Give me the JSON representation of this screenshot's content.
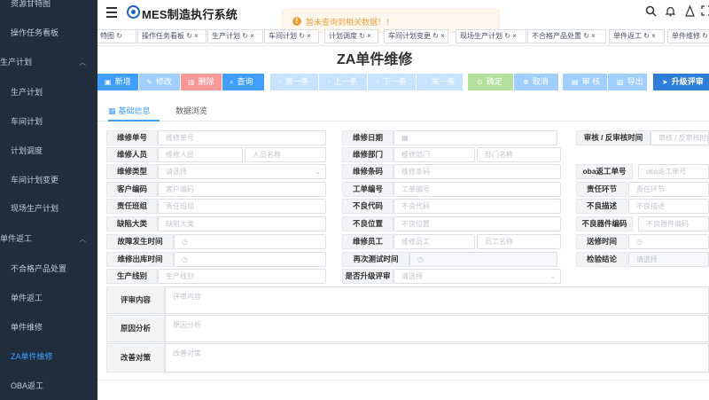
{
  "app": {
    "title": "MES制造执行系统"
  },
  "sidebar": {
    "items": [
      {
        "label": "资源甘特图"
      },
      {
        "label": "操作任务看板"
      },
      {
        "label": "生产计划",
        "chevron": "︿"
      },
      {
        "label": "生产计划"
      },
      {
        "label": "车间计划"
      },
      {
        "label": "计划调度"
      },
      {
        "label": "车间计划变更"
      },
      {
        "label": "现场生产计划"
      },
      {
        "label": "单件返工",
        "chevron": "︿"
      },
      {
        "label": "不合格产品处置"
      },
      {
        "label": "单件返工"
      },
      {
        "label": "单件维修"
      },
      {
        "label": "ZA单件维修"
      },
      {
        "label": "OBA返工"
      }
    ]
  },
  "toast": {
    "text": "暂未查询到相关数据！！"
  },
  "tags": [
    {
      "label": "特图 ↻"
    },
    {
      "label": "操作任务看板 ↻ ×"
    },
    {
      "label": "生产计划 ↻ ×"
    },
    {
      "label": "车间计划 ↻ ×"
    },
    {
      "label": "计划调度 ↻ ×"
    },
    {
      "label": "车间计划变更 ↻ ×"
    },
    {
      "label": "现场生产计划 ↻ ×"
    },
    {
      "label": "不合格产品处置 ↻ ×"
    },
    {
      "label": "单件返工 ↻ ×"
    },
    {
      "label": "单件维修 ↻"
    }
  ],
  "page": {
    "title": "ZA单件维修"
  },
  "toolbar": {
    "new": "新增",
    "edit": "修改",
    "delete": "删除",
    "query": "查询",
    "first": "第一条",
    "prev": "上一条",
    "next": "下一条",
    "last": "末一条",
    "confirm": "确定",
    "cancel": "取消",
    "audit": "审 核",
    "export": "导出",
    "upgrade": "升级评审"
  },
  "tabs": {
    "basic": "基础信息",
    "browse": "数据浏览"
  },
  "form": {
    "repair_no": {
      "label": "维修单号",
      "placeholder": "维修单号"
    },
    "repair_date": {
      "label": "维修日期"
    },
    "audit_time": {
      "label": "审核 / 反审核时间",
      "placeholder": "审核 / 反审核时间"
    },
    "repairer": {
      "label": "维修人员",
      "placeholder1": "维修人员",
      "placeholder2": "人员名称"
    },
    "repair_dept": {
      "label": "维修部门",
      "placeholder1": "维修部门",
      "placeholder2": "部门名称"
    },
    "repair_type": {
      "label": "维修类型",
      "placeholder": "请选择"
    },
    "repair_barcode": {
      "label": "维修条码",
      "placeholder": "维修条码"
    },
    "oba_no": {
      "label": "oba返工单号",
      "placeholder": "oba返工单号"
    },
    "customer_code": {
      "label": "客户编码",
      "placeholder": "客户编码"
    },
    "work_order": {
      "label": "工单编号",
      "placeholder": "工单编号"
    },
    "resp_stage": {
      "label": "责任环节",
      "placeholder": "责任环节"
    },
    "resp_team": {
      "label": "责任班组",
      "placeholder": "责任班组"
    },
    "defect_code": {
      "label": "不良代码",
      "placeholder": "不良代码"
    },
    "defect_desc": {
      "label": "不良描述",
      "placeholder": "不良描述"
    },
    "defect_class": {
      "label": "缺陷大类",
      "placeholder": "缺陷大类"
    },
    "defect_pos": {
      "label": "不良位置",
      "placeholder": "不良位置"
    },
    "defect_part": {
      "label": "不良器件编码",
      "placeholder": "不良器件编码"
    },
    "fault_time": {
      "label": "故障发生时间"
    },
    "repair_staff": {
      "label": "维修员工",
      "placeholder1": "维修员工",
      "placeholder2": "员工名称"
    },
    "send_time": {
      "label": "送修时间"
    },
    "out_time": {
      "label": "维修出库时间"
    },
    "retest_time": {
      "label": "再次测试时间"
    },
    "check_result": {
      "label": "检验结论",
      "placeholder": "请选择"
    },
    "prod_line": {
      "label": "生产线别",
      "placeholder": "生产线别"
    },
    "upgrade_review": {
      "label": "是否升级评审",
      "placeholder": "请选择"
    },
    "review_content": {
      "label": "评审内容",
      "placeholder": "评审内容"
    },
    "cause_analysis": {
      "label": "原因分析",
      "placeholder": "原因分析"
    },
    "improvement": {
      "label": "改善对策",
      "placeholder": "改善对策"
    }
  },
  "colors": {
    "sidebar_bg": "#1f2d3d",
    "accent": "#409eff",
    "primary_btn": "#409eff",
    "danger_btn": "#f89898",
    "nav_btn": "#a0cfff",
    "success_btn": "#95d475",
    "info_btn": "#79bbff",
    "upgrade_btn": "#2c7ed8",
    "warning": "#e6a23c"
  },
  "icons": [
    "menu-icon",
    "logo-icon",
    "search-icon",
    "bell-icon",
    "user-icon",
    "fullscreen-icon",
    "calendar-icon",
    "clock-icon",
    "chevron-down-icon"
  ]
}
